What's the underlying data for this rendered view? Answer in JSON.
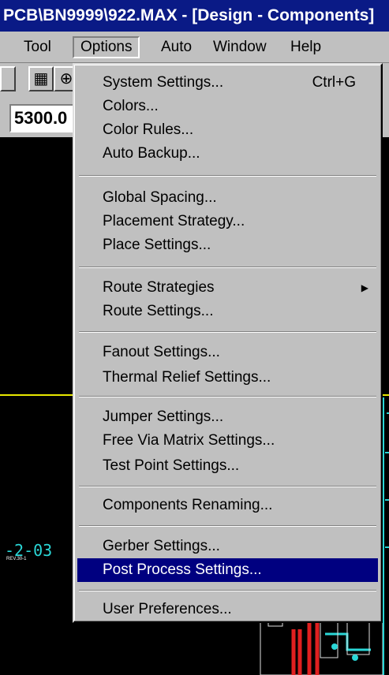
{
  "window": {
    "title": "PCB\\BN9999\\922.MAX - [Design - Components]"
  },
  "menubar": [
    {
      "id": "tool",
      "label": "Tool",
      "mnemonic": "T"
    },
    {
      "id": "options",
      "label": "Options",
      "mnemonic": "O"
    },
    {
      "id": "auto",
      "label": "Auto",
      "mnemonic": "A"
    },
    {
      "id": "window",
      "label": "Window",
      "mnemonic": "W"
    },
    {
      "id": "help",
      "label": "Help",
      "mnemonic": "H"
    }
  ],
  "toolbar": {
    "coordinate": "5300.0"
  },
  "canvas": {
    "board_text": "-2-03",
    "board_small": "REV.30-1"
  },
  "options_menu": {
    "items": [
      {
        "label": "System Settings...",
        "shortcut": "Ctrl+G"
      },
      {
        "label": "Colors..."
      },
      {
        "label": "Color Rules..."
      },
      {
        "label": "Auto Backup..."
      },
      {
        "label": "Global Spacing..."
      },
      {
        "label": "Placement Strategy..."
      },
      {
        "label": "Place Settings..."
      },
      {
        "label": "Route Strategies",
        "submenu": true
      },
      {
        "label": "Route Settings..."
      },
      {
        "label": "Fanout Settings..."
      },
      {
        "label": "Thermal Relief Settings..."
      },
      {
        "label": "Jumper Settings..."
      },
      {
        "label": "Free Via Matrix Settings..."
      },
      {
        "label": "Test Point Settings..."
      },
      {
        "label": "Components Renaming..."
      },
      {
        "label": "Gerber Settings..."
      },
      {
        "label": "Post Process Settings...",
        "highlighted": true
      },
      {
        "label": "User Preferences..."
      }
    ]
  },
  "colors": {
    "title_bg": "#0a1a86",
    "highlight": "#000080",
    "menu_bg": "#c0c0c0",
    "trace": "#2ad7d7",
    "board_outline": "#e8e800"
  }
}
